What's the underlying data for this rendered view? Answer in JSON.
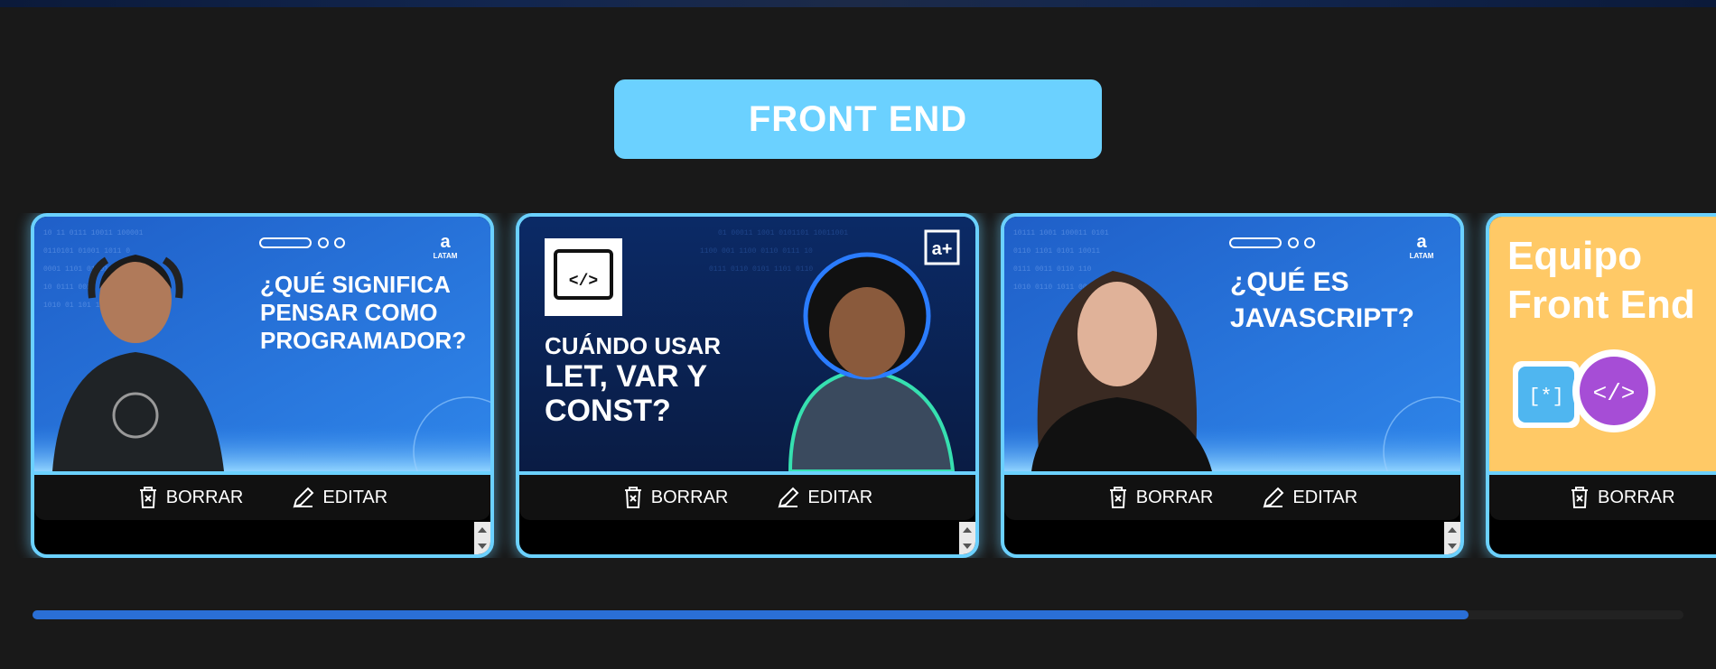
{
  "category": {
    "title": "FRONT END",
    "color": "#6bd1ff"
  },
  "actions": {
    "delete_label": "BORRAR",
    "edit_label": "EDITAR"
  },
  "cards": [
    {
      "thumb_line1": "¿QUÉ SIGNIFICA",
      "thumb_line2": "PENSAR COMO",
      "thumb_line3": "PROGRAMADOR?",
      "brand": "LATAM"
    },
    {
      "thumb_line1": "CUÁNDO USAR",
      "thumb_line2": "LET, VAR Y",
      "thumb_line3": "CONST?",
      "brand": "a+"
    },
    {
      "thumb_line1": "¿QUÉ ES",
      "thumb_line2": "JAVASCRIPT?",
      "brand": "LATAM"
    },
    {
      "thumb_line1": "Equipo",
      "thumb_line2": "Front End"
    }
  ],
  "scroll_progress": 0.87,
  "icons": {
    "delete": "trash-icon",
    "edit": "pencil-icon"
  },
  "colors": {
    "background": "#191919",
    "accent": "#6bd1ff",
    "progress": "#2a6fd6",
    "thumb_blue": "#2979e0",
    "card4_bg": "#ffc966"
  }
}
